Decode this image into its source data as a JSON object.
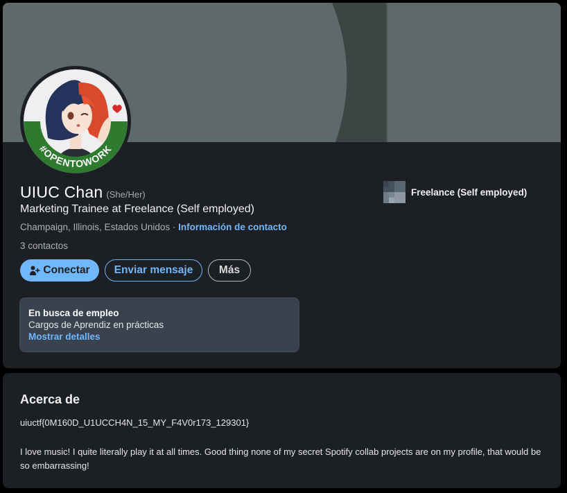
{
  "profile": {
    "name": "UIUC Chan",
    "pronouns": "(She/Her)",
    "headline": "Marketing Trainee at Freelance (Self employed)",
    "location": "Champaign, Illinois, Estados Unidos",
    "separator": " · ",
    "contact_info_link": "Información de contacto",
    "connections": "3 contactos",
    "avatar_badge": "#OPENTOWORK",
    "avatar_badge_color": "#2e7a2e"
  },
  "actions": {
    "connect_label": "Conectar",
    "message_label": "Enviar mensaje",
    "more_label": "Más"
  },
  "open_to_work": {
    "title": "En busca de empleo",
    "roles": "Cargos de Aprendiz en prácticas",
    "details_link": "Mostrar detalles"
  },
  "experience": {
    "company": "Freelance (Self employed)"
  },
  "about": {
    "title": "Acerca de",
    "flag": "uiuctf{0M160D_U1UCCH4N_15_MY_F4V0r173_129301}",
    "text": "I love music! I quite literally play it at all times. Good thing none of my secret Spotify collab projects are on my profile, that would be so embarrassing!"
  },
  "colors": {
    "accent": "#71b7fb",
    "card_bg": "#1c1f23",
    "banner": "#5e6a6a",
    "jobs_box": "#38434f"
  }
}
